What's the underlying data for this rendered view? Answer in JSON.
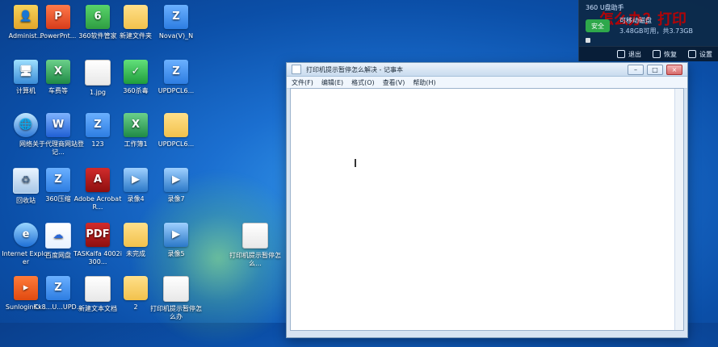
{
  "desktop": {
    "icons": [
      {
        "label": "Administ...",
        "icon": "user-icon"
      },
      {
        "label": "PowerPnt...",
        "icon": "ppt-icon"
      },
      {
        "label": "360软件管家",
        "icon": "app360-icon"
      },
      {
        "label": "新建文件夹",
        "icon": "folder-icon"
      },
      {
        "label": "Nova(V)_N",
        "icon": "zip-icon"
      },
      {
        "label": "计算机",
        "icon": "pc-icon"
      },
      {
        "label": "车费等",
        "icon": "excel-icon"
      },
      {
        "label": "1.jpg",
        "icon": "file-icon"
      },
      {
        "label": "360杀毒",
        "icon": "shield-icon"
      },
      {
        "label": "UPDPCL6...",
        "icon": "zip-icon"
      },
      {
        "label": "网络",
        "icon": "network-icon"
      },
      {
        "label": "关于代理商网站登记...",
        "icon": "word-icon"
      },
      {
        "label": "123",
        "icon": "zip-icon"
      },
      {
        "label": "工作簿1",
        "icon": "excel-icon"
      },
      {
        "label": "UPDPCL6...",
        "icon": "folder-icon"
      },
      {
        "label": "回收站",
        "icon": "recycle-icon"
      },
      {
        "label": "360压缩",
        "icon": "zip-icon"
      },
      {
        "label": "Adobe Acrobat R...",
        "icon": "pdf-icon"
      },
      {
        "label": "录像4",
        "icon": "video-icon"
      },
      {
        "label": "录像7",
        "icon": "video-icon"
      },
      {
        "label": "Internet Explorer",
        "icon": "ie-icon"
      },
      {
        "label": "百度网盘",
        "icon": "baidu-icon"
      },
      {
        "label": "TASKalfa 4002i 300...",
        "icon": "pdf-icon"
      },
      {
        "label": "未完成",
        "icon": "folder-icon"
      },
      {
        "label": "录像5",
        "icon": "video-icon"
      },
      {
        "label": "打印机提示暂停怎么...",
        "icon": "file-icon"
      },
      {
        "label": "SunloginCl...",
        "icon": "orange-icon"
      },
      {
        "label": "Kx8...U...UPD...",
        "icon": "zip-icon"
      },
      {
        "label": "新建文本文档",
        "icon": "file-icon"
      },
      {
        "label": "2",
        "icon": "folder-icon"
      },
      {
        "label": "打印机提示暂停怎么办",
        "icon": "file-icon"
      }
    ]
  },
  "notepad": {
    "window_title": "打印机提示暂停怎么解决 - 记事本",
    "menu": [
      "文件(F)",
      "编辑(E)",
      "格式(O)",
      "查看(V)",
      "帮助(H)"
    ],
    "body_text": ""
  },
  "widget": {
    "title": "360 U盘助手",
    "watermark": "怎么办？打印",
    "status_label": "安全",
    "line1": "可移动磁盘",
    "line2": "3.48GB可用，共3.73GB",
    "actions": [
      "退出",
      "恢复",
      "设置"
    ]
  }
}
